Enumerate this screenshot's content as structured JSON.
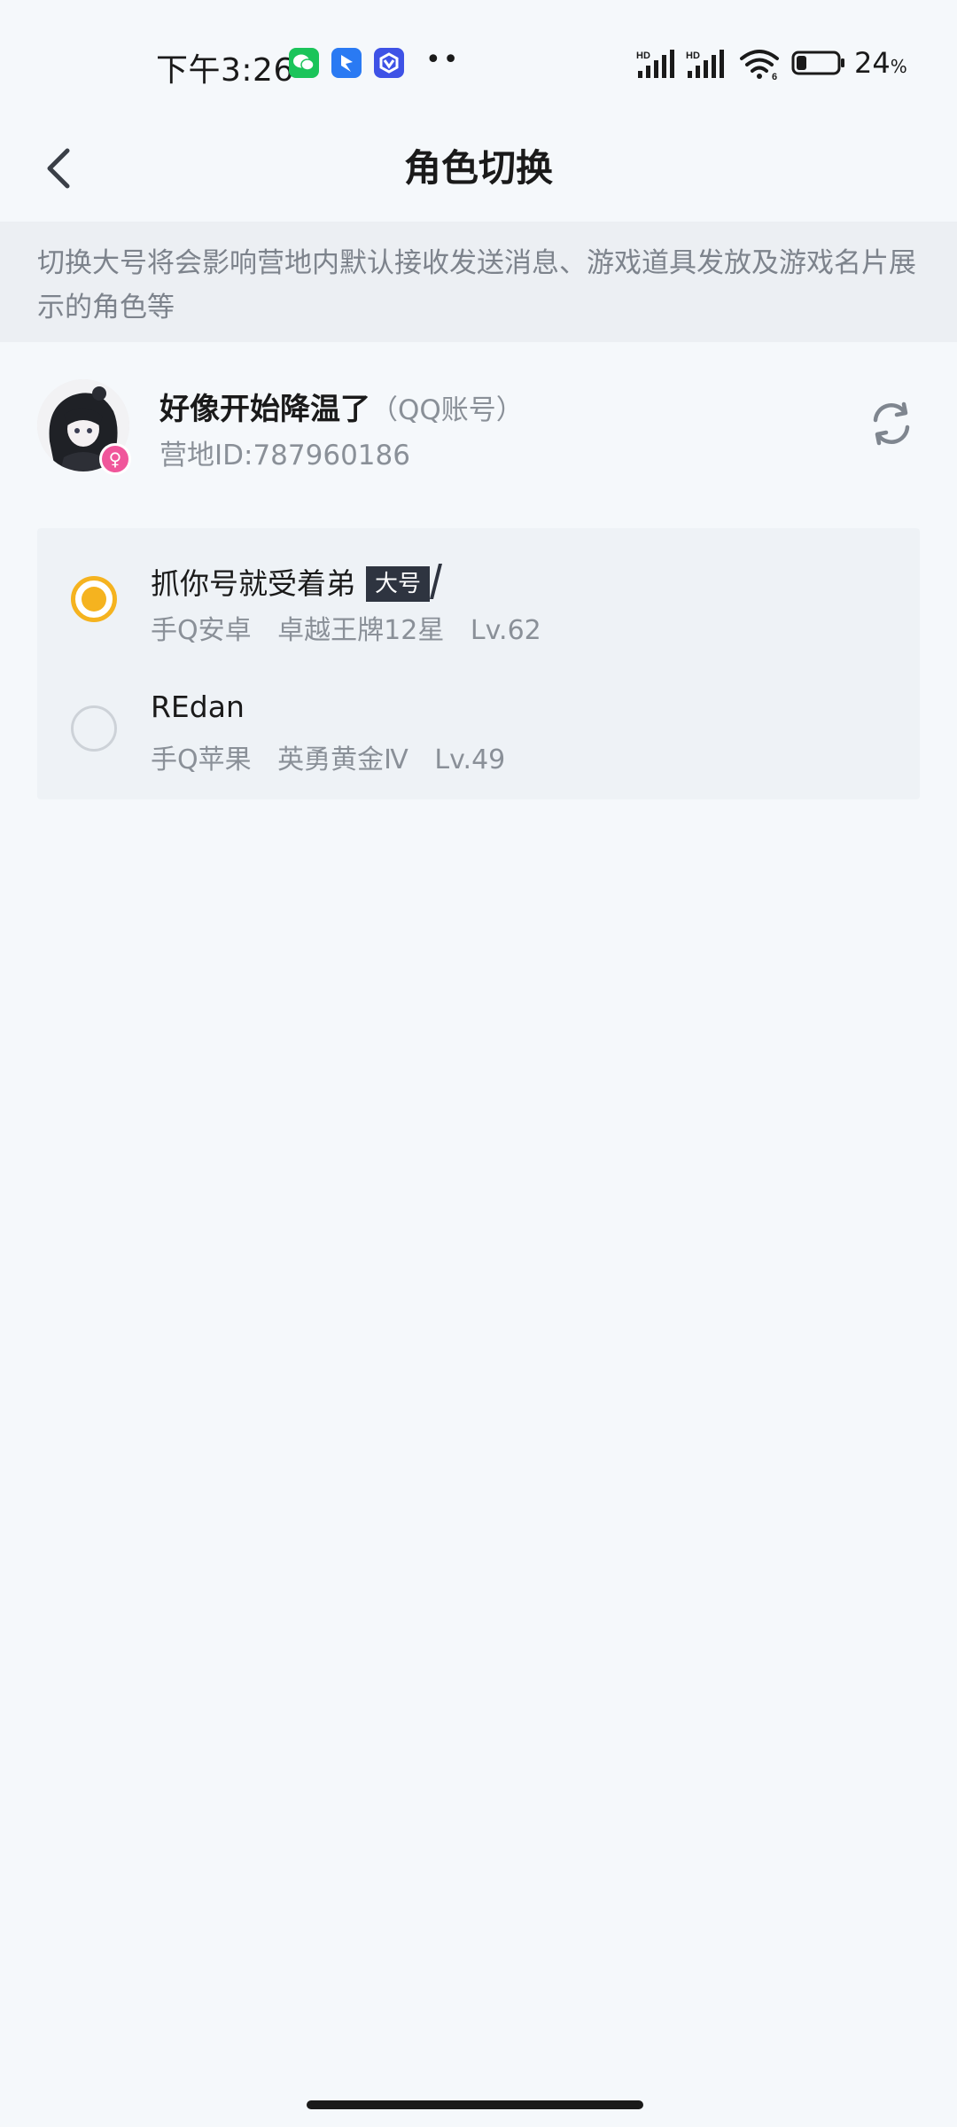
{
  "status_bar": {
    "time": "下午3:26",
    "dots": "••",
    "battery_percent": "24",
    "battery_unit": "%",
    "battery_level": 0.24,
    "network_label_1": "HD",
    "network_label_2": "HD",
    "wifi_sub": "6",
    "notification_icons": [
      "wechat-icon",
      "blue-app-icon",
      "blue-app-icon"
    ]
  },
  "header": {
    "title": "角色切换",
    "back_icon": "chevron-left-icon"
  },
  "notice": {
    "text": "切换大号将会影响营地内默认接收发送消息、游戏道具发放及游戏名片展示的角色等"
  },
  "account": {
    "name": "好像开始降温了",
    "type": "（QQ账号）",
    "camp_id": "营地ID:787960186",
    "gender_symbol": "♀",
    "refresh_icon": "refresh-icon"
  },
  "roles": [
    {
      "name": "抓你号就受着弟",
      "badge": "大号",
      "platform": "手Q安卓",
      "rank": "卓越王牌12星",
      "level": "Lv.62",
      "selected": true
    },
    {
      "name": "REdan",
      "badge": "",
      "platform": "手Q苹果",
      "rank": "英勇黄金Ⅳ",
      "level": "Lv.49",
      "selected": false
    }
  ],
  "colors": {
    "background": "#f5f8fb",
    "notice_bg": "#eceff3",
    "card_bg": "#eef2f6",
    "accent": "#f5b31f",
    "muted_text": "#8a9098",
    "badge_bg": "#2e3440",
    "gender_badge": "#f0569b"
  }
}
